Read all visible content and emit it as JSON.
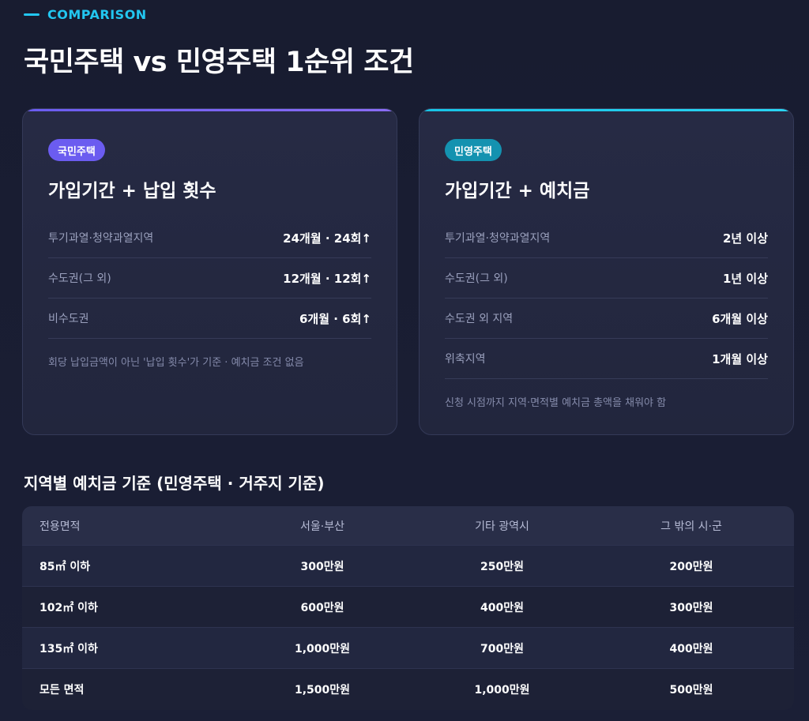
{
  "header": {
    "eyebrow": "COMPARISON",
    "title": "국민주택 vs 민영주택 1순위 조건"
  },
  "colors": {
    "accent_cyan": "#22c6f0",
    "accent_purple": "#6b5cf0",
    "accent_teal": "#1492b0",
    "background": "#1a1e34"
  },
  "cards": {
    "public": {
      "badge": "국민주택",
      "heading": "가입기간 + 납입 횟수",
      "rows": [
        {
          "label": "투기과열·청약과열지역",
          "value": "24개월 · 24회↑"
        },
        {
          "label": "수도권(그 외)",
          "value": "12개월 · 12회↑"
        },
        {
          "label": "비수도권",
          "value": "6개월 · 6회↑"
        }
      ],
      "note": "회당 납입금액이 아닌 '납입 횟수'가 기준 · 예치금 조건 없음"
    },
    "private": {
      "badge": "민영주택",
      "heading": "가입기간 + 예치금",
      "rows": [
        {
          "label": "투기과열·청약과열지역",
          "value": "2년 이상"
        },
        {
          "label": "수도권(그 외)",
          "value": "1년 이상"
        },
        {
          "label": "수도권 외 지역",
          "value": "6개월 이상"
        },
        {
          "label": "위축지역",
          "value": "1개월 이상"
        }
      ],
      "note": "신청 시점까지 지역·면적별 예치금 총액을 채워야 함"
    }
  },
  "deposit_table": {
    "title": "지역별 예치금 기준 (민영주택 · 거주지 기준)",
    "headers": [
      "전용면적",
      "서울·부산",
      "기타 광역시",
      "그 밖의 시·군"
    ],
    "rows": [
      [
        "85㎡ 이하",
        "300만원",
        "250만원",
        "200만원"
      ],
      [
        "102㎡ 이하",
        "600만원",
        "400만원",
        "300만원"
      ],
      [
        "135㎡ 이하",
        "1,000만원",
        "700만원",
        "400만원"
      ],
      [
        "모든 면적",
        "1,500만원",
        "1,000만원",
        "500만원"
      ]
    ]
  }
}
